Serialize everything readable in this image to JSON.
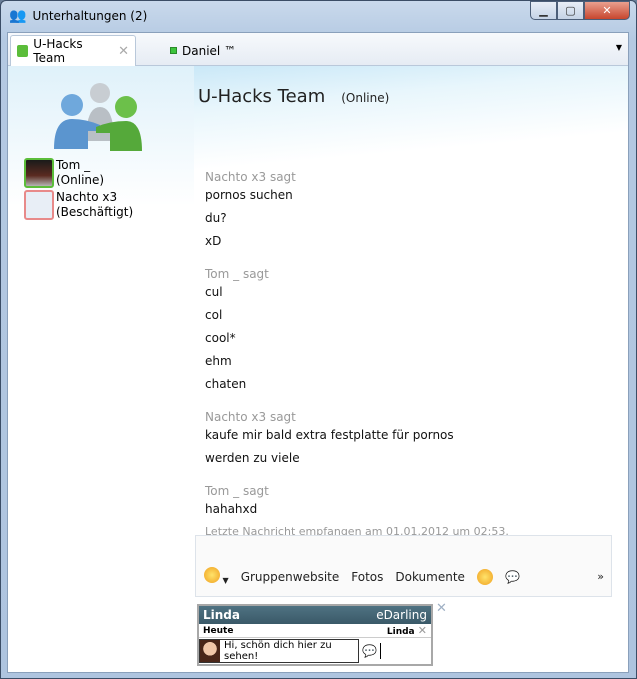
{
  "window": {
    "title": "Unterhaltungen (2)"
  },
  "tabs": [
    {
      "label": "U-Hacks Team",
      "active": true
    },
    {
      "label": "Daniel ™",
      "active": false
    }
  ],
  "chat": {
    "name": "U-Hacks Team",
    "status": "(Online)"
  },
  "members": [
    {
      "name": "Tom _",
      "status": "(Online)",
      "status_color": "#5bbd3a"
    },
    {
      "name": "Nachto x3",
      "status": "(Beschäftigt)",
      "status_color": "#e88a8a"
    }
  ],
  "messages": [
    {
      "sender": "Nachto x3 sagt",
      "lines": [
        "pornos suchen",
        "du?",
        "xD"
      ]
    },
    {
      "sender": "Tom _ sagt",
      "lines": [
        "cul",
        "col",
        "cool*",
        "ehm",
        "chaten"
      ]
    },
    {
      "sender": "Nachto x3 sagt",
      "lines": [
        "kaufe mir bald extra festplatte für pornos",
        "werden zu viele"
      ]
    },
    {
      "sender": "Tom _ sagt",
      "lines": [
        "hahahxd"
      ]
    }
  ],
  "last_message": "Letzte Nachricht empfangen am 01.01.2012 um 02:53.",
  "toolbar": {
    "emoticon_icon": "smiley-icon",
    "items": [
      "Gruppenwebsite",
      "Fotos",
      "Dokumente"
    ],
    "more": "»"
  },
  "ad": {
    "name": "Linda",
    "brand": "eDarling",
    "today": "Heute",
    "recipient": "Linda",
    "message": "Hi, schön dich hier zu sehen!"
  }
}
